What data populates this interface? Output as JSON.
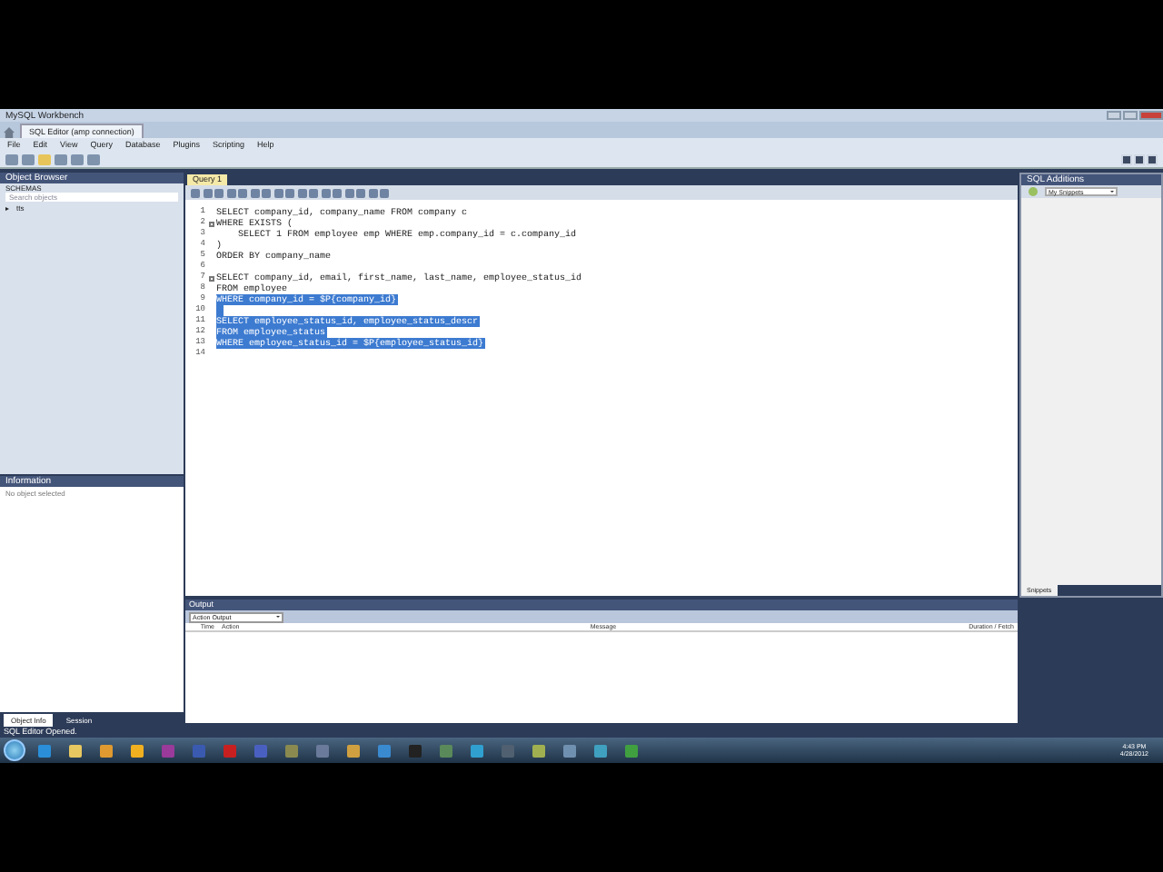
{
  "window": {
    "title": "MySQL Workbench"
  },
  "window_tabs": [
    {
      "label": "SQL Editor (amp connection)",
      "selected": true
    }
  ],
  "menu": [
    "File",
    "Edit",
    "View",
    "Query",
    "Database",
    "Plugins",
    "Scripting",
    "Help"
  ],
  "object_browser": {
    "title": "Object Browser",
    "schemas_label": "SCHEMAS",
    "search": {
      "placeholder": "Search objects"
    },
    "tree": [
      {
        "label": "tts",
        "expanded": false
      }
    ]
  },
  "information": {
    "title": "Information",
    "text": "No object selected"
  },
  "left_tabs": [
    {
      "label": "Object Info",
      "selected": true
    },
    {
      "label": "Session",
      "selected": false
    }
  ],
  "editor": {
    "tabs": [
      {
        "label": "Query 1",
        "selected": true
      }
    ],
    "lines": [
      {
        "number": "1",
        "text": "SELECT company_id, company_name FROM company c",
        "selected": false,
        "fold": false
      },
      {
        "number": "2",
        "text": "WHERE EXISTS (",
        "selected": false,
        "fold": true
      },
      {
        "number": "3",
        "text": "    SELECT 1 FROM employee emp WHERE emp.company_id = c.company_id",
        "selected": false,
        "fold": false
      },
      {
        "number": "4",
        "text": ")",
        "selected": false,
        "fold": false
      },
      {
        "number": "5",
        "text": "ORDER BY company_name",
        "selected": false,
        "fold": false
      },
      {
        "number": "6",
        "selected": false,
        "fold": false
      },
      {
        "number": "7",
        "text": "SELECT company_id, email, first_name, last_name, employee_status_id",
        "selected": false,
        "fold": true
      },
      {
        "number": "8",
        "text": "FROM employee",
        "selected": false,
        "fold": false
      },
      {
        "number": "9",
        "text": "WHERE company_id = $P{company_id}",
        "selected": true,
        "fold": false
      },
      {
        "number": "10",
        "selected": true,
        "fold": false
      },
      {
        "number": "11",
        "text": "SELECT employee_status_id, employee_status_descr",
        "selected": true,
        "fold": false
      },
      {
        "number": "12",
        "text": "FROM employee_status",
        "selected": true,
        "fold": false
      },
      {
        "number": "13",
        "text": "WHERE employee_status_id = $P{employee_status_id}",
        "selected": true,
        "fold": false
      },
      {
        "number": "14",
        "selected": false,
        "fold": false
      }
    ]
  },
  "output": {
    "title": "Output",
    "dropdown": "Action Output",
    "columns": [
      "Time",
      "Action",
      "Message",
      "Duration / Fetch"
    ]
  },
  "sql_additions": {
    "title": "SQL Additions",
    "dropdown": "My Snippets",
    "tabs": [
      {
        "label": "Snippets",
        "selected": true
      }
    ]
  },
  "status_bar": "SQL Editor Opened.",
  "taskbar": {
    "time": "4:43 PM",
    "date": "4/28/2012"
  }
}
